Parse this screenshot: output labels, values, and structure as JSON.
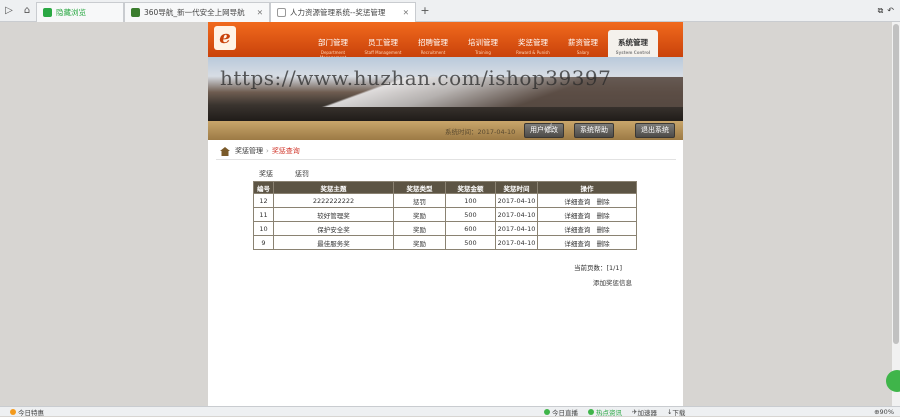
{
  "browser": {
    "tabs": [
      {
        "label": "隐藏浏览",
        "color": "#2aa843"
      },
      {
        "label": "360导航_新一代安全上网导航",
        "color": "#3b7d2e"
      },
      {
        "label": "人力资源管理系统--奖惩管理",
        "color": "#ffffff"
      }
    ]
  },
  "header": {
    "logo": "e",
    "menu": [
      {
        "label": "部门管理",
        "sub": "Department Management"
      },
      {
        "label": "员工管理",
        "sub": "Staff Management"
      },
      {
        "label": "招聘管理",
        "sub": "Recruitment"
      },
      {
        "label": "培训管理",
        "sub": "Training"
      },
      {
        "label": "奖惩管理",
        "sub": "Reward & Punish"
      },
      {
        "label": "薪资管理",
        "sub": "Salary"
      },
      {
        "label": "系统管理",
        "sub": "System Control"
      }
    ],
    "watermark": "https://www.huzhan.com/ishop39397",
    "date_label": "系统时间：2017-04-10",
    "buttons": [
      "用户修改",
      "系统帮助",
      "退出系统"
    ]
  },
  "breadcrumb": {
    "parent": "奖惩管理",
    "current": "奖惩查询"
  },
  "filter": {
    "label": "奖惩",
    "value": "惩罚"
  },
  "table": {
    "headers": [
      "编号",
      "奖惩主题",
      "奖惩类型",
      "奖惩金额",
      "奖惩时间",
      "操作"
    ],
    "rows": [
      {
        "id": "12",
        "subject": "2222222222",
        "type": "惩罚",
        "amount": "100",
        "date": "2017-04-10",
        "detail": "详细查询",
        "del": "删除"
      },
      {
        "id": "11",
        "subject": "较好管理奖",
        "type": "奖励",
        "amount": "500",
        "date": "2017-04-10",
        "detail": "详细查询",
        "del": "删除"
      },
      {
        "id": "10",
        "subject": "保护安全奖",
        "type": "奖励",
        "amount": "600",
        "date": "2017-04-10",
        "detail": "详细查询",
        "del": "删除"
      },
      {
        "id": "9",
        "subject": "最佳服务奖",
        "type": "奖励",
        "amount": "500",
        "date": "2017-04-10",
        "detail": "详细查询",
        "del": "删除"
      }
    ]
  },
  "pager": "当前页数：[1/1]",
  "add_link": "添加奖惩信息",
  "status": {
    "left": "今日特惠",
    "items": [
      "今日直播",
      "热点资讯",
      "加速器",
      "下载"
    ],
    "zoom": "90%"
  }
}
